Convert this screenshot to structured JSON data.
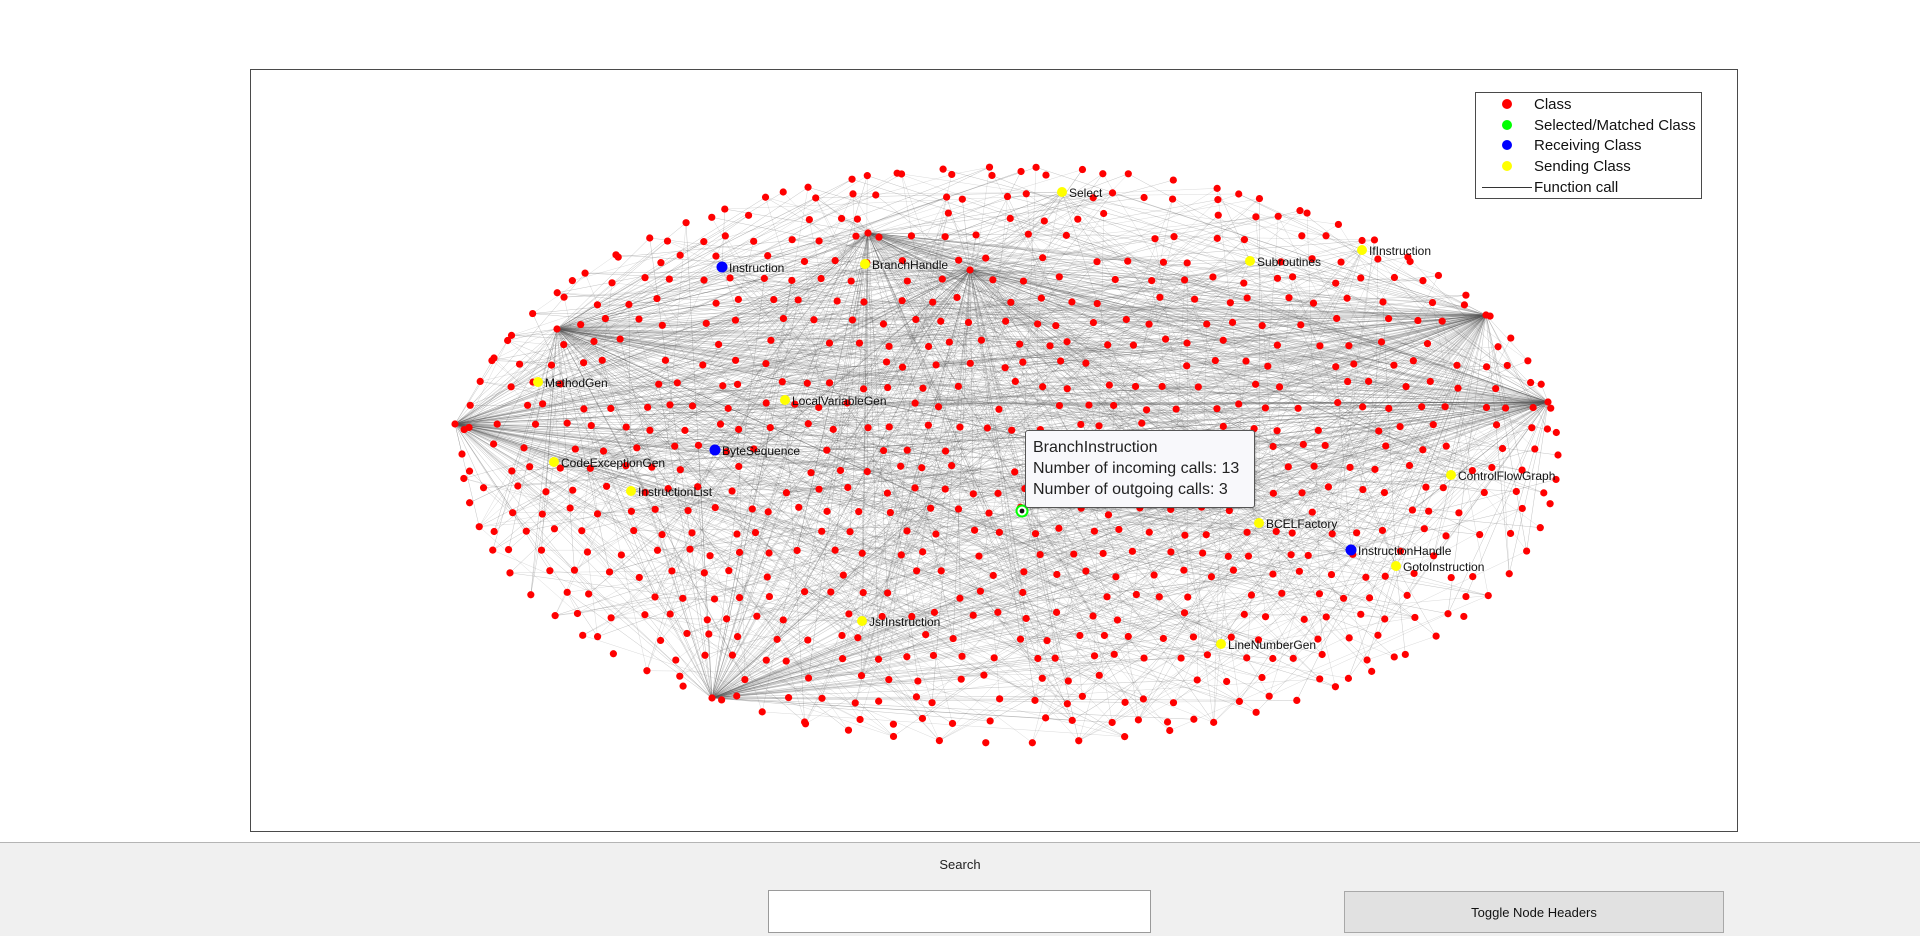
{
  "legend": {
    "items": [
      {
        "label": "Class",
        "color": "#ff0000",
        "kind": "marker"
      },
      {
        "label": "Selected/Matched Class",
        "color": "#00ff00",
        "kind": "marker"
      },
      {
        "label": "Receiving Class",
        "color": "#0000ff",
        "kind": "marker"
      },
      {
        "label": "Sending Class",
        "color": "#ffff00",
        "kind": "marker"
      },
      {
        "label": "Function call",
        "color": "#333333",
        "kind": "line"
      }
    ]
  },
  "tooltip": {
    "title": "BranchInstruction",
    "incoming": "Number of incoming calls: 13",
    "outgoing": "Number of outgoing calls: 3"
  },
  "labeled_nodes": [
    {
      "name": "Select",
      "role": "sending"
    },
    {
      "name": "IfInstruction",
      "role": "sending"
    },
    {
      "name": "Instruction",
      "role": "receiving"
    },
    {
      "name": "BranchHandle",
      "role": "sending"
    },
    {
      "name": "Subroutines",
      "role": "sending"
    },
    {
      "name": "MethodGen",
      "role": "sending"
    },
    {
      "name": "LocalVariableGen",
      "role": "sending"
    },
    {
      "name": "ByteSequence",
      "role": "receiving"
    },
    {
      "name": "CodeExceptionGen",
      "role": "sending"
    },
    {
      "name": "InstructionList",
      "role": "sending"
    },
    {
      "name": "ControlFlowGraph",
      "role": "sending"
    },
    {
      "name": "BCELFactory",
      "role": "sending"
    },
    {
      "name": "InstructionHandle",
      "role": "receiving"
    },
    {
      "name": "GotoInstruction",
      "role": "sending"
    },
    {
      "name": "JsrInstruction",
      "role": "sending"
    },
    {
      "name": "LineNumberGen",
      "role": "sending"
    }
  ],
  "selected_node": {
    "name": "BranchInstruction",
    "role": "selected"
  },
  "colors": {
    "class": "#ff0000",
    "selected": "#00ff00",
    "receiving": "#0000ff",
    "sending": "#ffff00",
    "edge": "#555555"
  },
  "controls": {
    "search_label": "Search",
    "search_placeholder": "",
    "toggle_label": "Toggle Node Headers"
  }
}
